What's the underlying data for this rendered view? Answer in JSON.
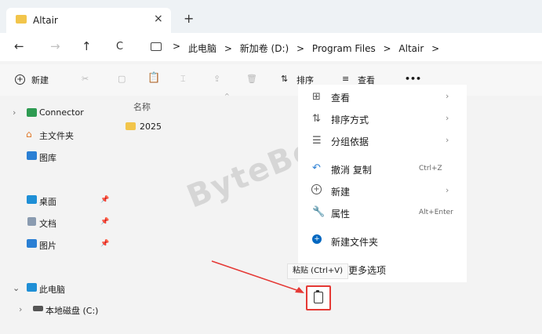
{
  "tab": {
    "title": "Altair",
    "close": "×",
    "new": "+"
  },
  "nav": {
    "back": "←",
    "forward": "→",
    "up": "↑",
    "refresh": "C"
  },
  "breadcrumb": [
    "此电脑",
    "新加卷 (D:)",
    "Program Files",
    "Altair"
  ],
  "breadcrumb_sep": ">",
  "toolbar": {
    "new_label": "新建",
    "sort_label": "排序",
    "view_label": "查看",
    "more": "•••"
  },
  "sidebar": {
    "connector": "Connector",
    "home": "主文件夹",
    "gallery": "图库",
    "desktop": "桌面",
    "documents": "文档",
    "pictures": "图片",
    "thispc": "此电脑",
    "localdisk": "本地磁盘 (C:)"
  },
  "main": {
    "column_name": "名称",
    "folder": "2025"
  },
  "context_menu": {
    "view": "查看",
    "sort": "排序方式",
    "group": "分组依据",
    "undo": "撤消 复制",
    "undo_shortcut": "Ctrl+Z",
    "new": "新建",
    "properties": "属性",
    "properties_shortcut": "Alt+Enter",
    "new_folder": "新建文件夹",
    "more_options": "更多选项"
  },
  "tooltip": "粘贴 (Ctrl+V)",
  "watermark": "ByteBeacon",
  "colors": {
    "accent": "#0067c0",
    "annotation": "#e53935",
    "folder": "#f2c54b"
  }
}
